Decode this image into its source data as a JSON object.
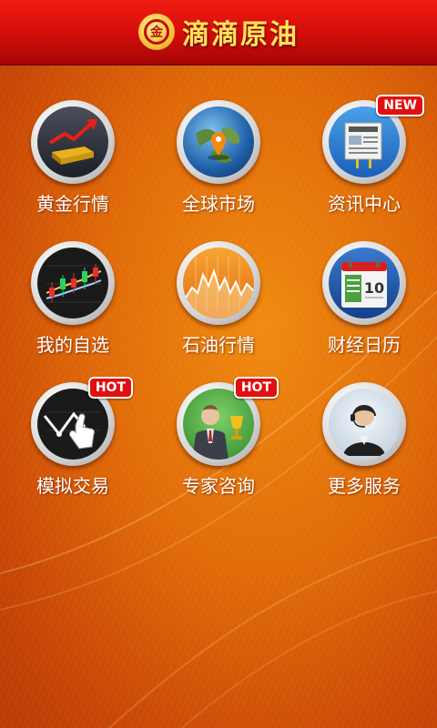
{
  "header": {
    "logo_text": "金",
    "title": "滴滴原油"
  },
  "menu": [
    {
      "label": "黄金行情",
      "icon": "gold-trend-icon"
    },
    {
      "label": "全球市场",
      "icon": "globe-map-pin-icon"
    },
    {
      "label": "资讯中心",
      "icon": "newspaper-icon",
      "badge": "NEW"
    },
    {
      "label": "我的自选",
      "icon": "candlestick-chart-icon"
    },
    {
      "label": "石油行情",
      "icon": "oil-chart-icon"
    },
    {
      "label": "财经日历",
      "icon": "calendar-icon",
      "calendar_day": "10"
    },
    {
      "label": "模拟交易",
      "icon": "touch-chart-icon",
      "badge": "HOT"
    },
    {
      "label": "专家咨询",
      "icon": "expert-trophy-icon",
      "badge": "HOT"
    },
    {
      "label": "更多服务",
      "icon": "customer-service-icon"
    }
  ],
  "colors": {
    "accent": "#d40e0b",
    "title": "#ffe45c",
    "badge": "#e01010"
  }
}
